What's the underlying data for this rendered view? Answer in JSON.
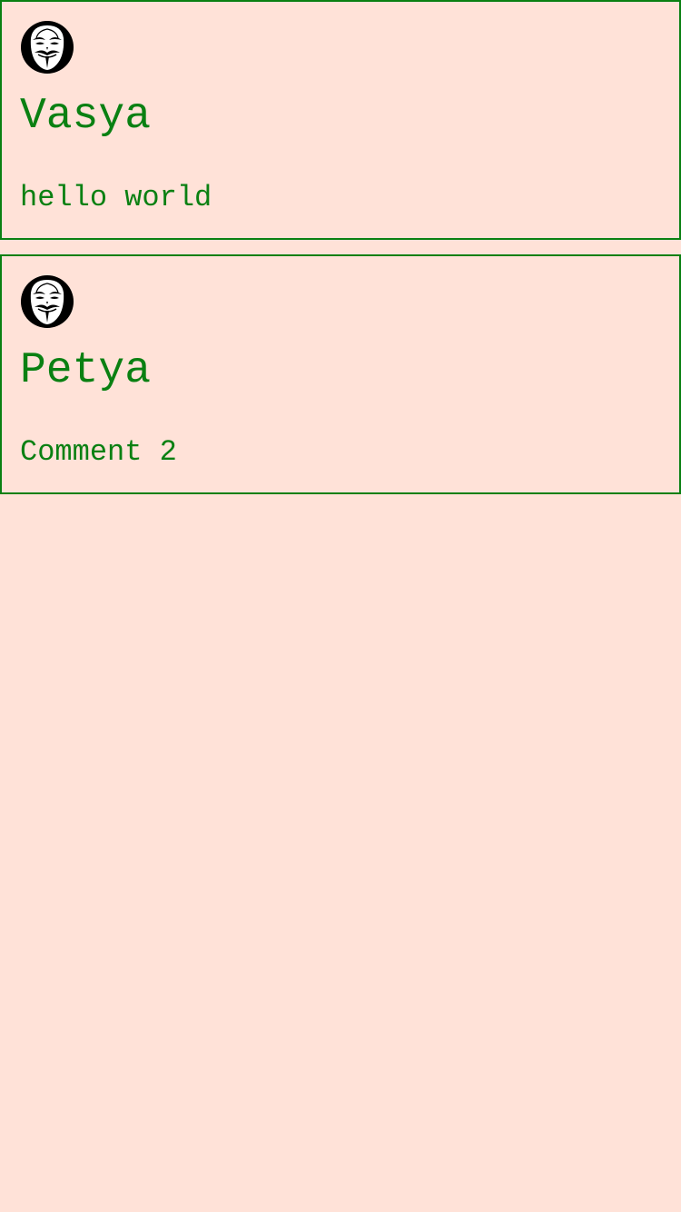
{
  "comments": [
    {
      "author": "Vasya",
      "text": "hello world",
      "avatar_icon": "guy-fawkes-mask-icon"
    },
    {
      "author": "Petya",
      "text": "Comment 2",
      "avatar_icon": "guy-fawkes-mask-icon"
    }
  ],
  "colors": {
    "background": "#ffe2d8",
    "accent": "#0a8012"
  }
}
